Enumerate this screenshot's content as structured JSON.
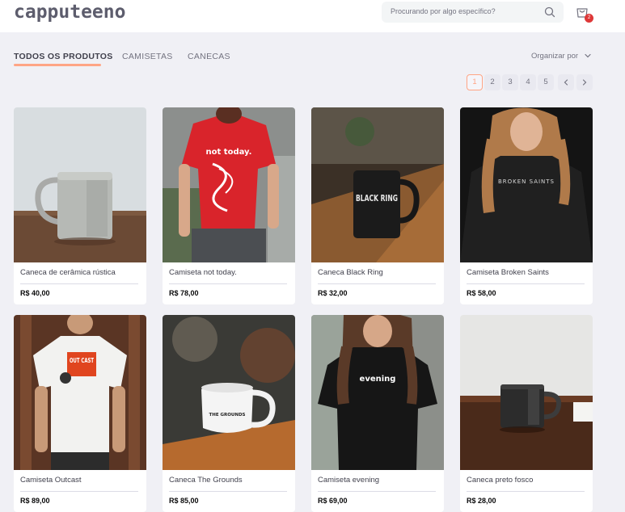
{
  "header": {
    "logo": "capputeeno",
    "search_placeholder": "Procurando por algo específico?",
    "cart_count": "2"
  },
  "tabs": [
    {
      "label": "TODOS OS PRODUTOS",
      "active": true
    },
    {
      "label": "CAMISETAS",
      "active": false
    },
    {
      "label": "CANECAS",
      "active": false
    }
  ],
  "sort": {
    "label": "Organizar por"
  },
  "pagination": {
    "pages": [
      "1",
      "2",
      "3",
      "4",
      "5"
    ],
    "current": "1",
    "prev_icon": "chevron-left-icon",
    "next_icon": "chevron-right-icon"
  },
  "products": [
    {
      "name": "Caneca de cerâmica rústica",
      "price": "R$ 40,00"
    },
    {
      "name": "Camiseta not today.",
      "price": "R$ 78,00",
      "print": "not today."
    },
    {
      "name": "Caneca Black Ring",
      "price": "R$ 32,00",
      "print": "BLACK RING"
    },
    {
      "name": "Camiseta Broken Saints",
      "price": "R$ 58,00",
      "print": "BROKEN SAINTS"
    },
    {
      "name": "Camiseta Outcast",
      "price": "R$ 89,00",
      "print": "OUT CAST"
    },
    {
      "name": "Caneca The Grounds",
      "price": "R$ 85,00",
      "print": "THE GROUNDS"
    },
    {
      "name": "Camiseta evening",
      "price": "R$ 69,00",
      "print": "evening"
    },
    {
      "name": "Caneca preto fosco",
      "price": "R$ 28,00"
    }
  ],
  "colors": {
    "accent": "#ffa585",
    "background": "#f0f0f5",
    "badge": "#de3838",
    "text": "#41414d"
  }
}
